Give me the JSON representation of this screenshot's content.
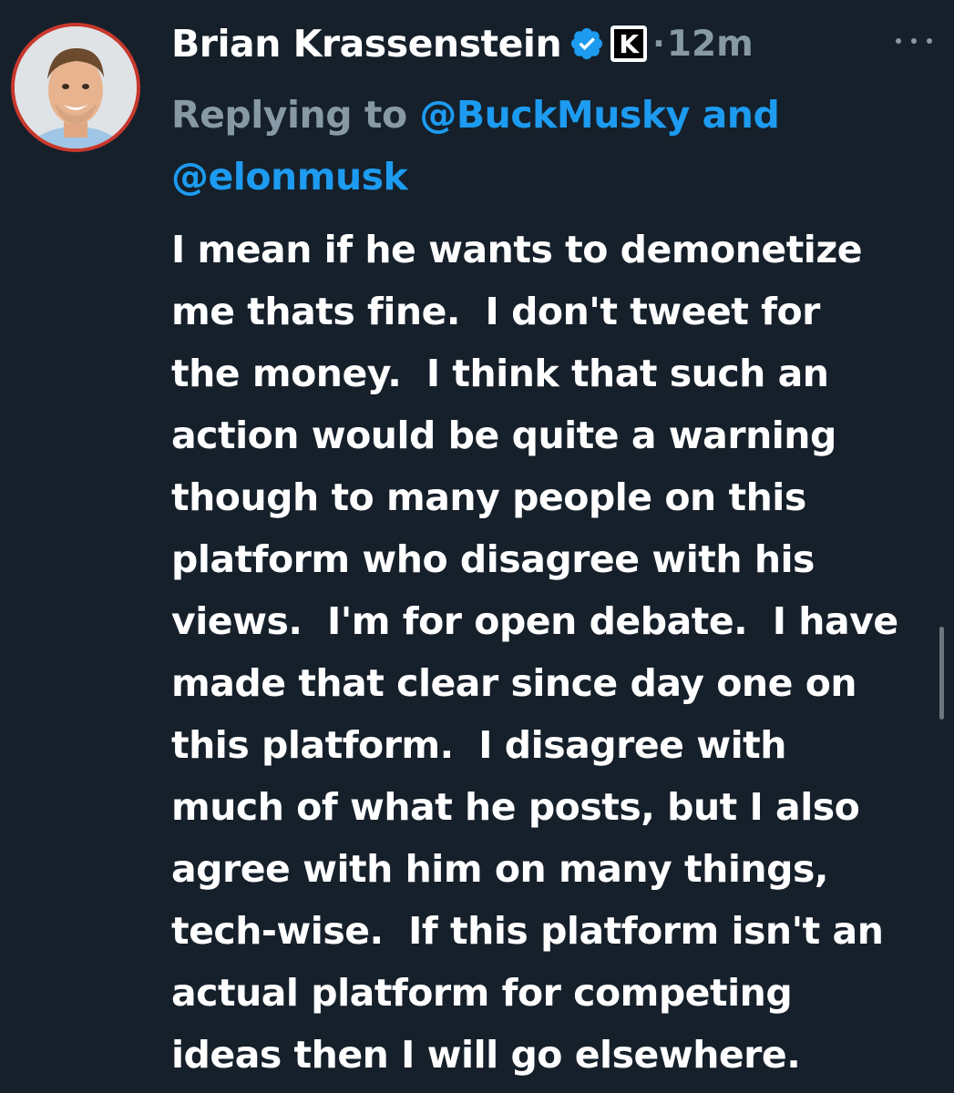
{
  "tweet": {
    "author_name": "Brian Krassenstein",
    "affiliate_letter": "K",
    "separator": "·",
    "timestamp": "12m",
    "reply": {
      "prefix": "Replying to ",
      "mention_1": "@BuckMusky",
      "joiner": " and",
      "mention_2": "@elonmusk"
    },
    "text_lines": [
      "I mean if he wants to demonetize",
      "me thats fine.  I don't tweet for",
      "the money.  I think that such an",
      "action would be quite a warning",
      "though to many people on this",
      "platform who disagree with his",
      "views.  I'm for open debate.  I have",
      "made that clear since day one on",
      "this platform.  I disagree with",
      "much of what he posts, but I also",
      "agree with him on many things,",
      "tech-wise.  If this platform isn't an",
      "actual platform for competing",
      "ideas then I will go elsewhere."
    ]
  },
  "icons": {
    "verified": "verified-badge-icon",
    "more": "more-options-icon"
  },
  "colors": {
    "background": "#15202b",
    "text": "#ffffff",
    "muted": "#8899a6",
    "link": "#1d9bf0",
    "avatar_ring": "#c8382c"
  }
}
